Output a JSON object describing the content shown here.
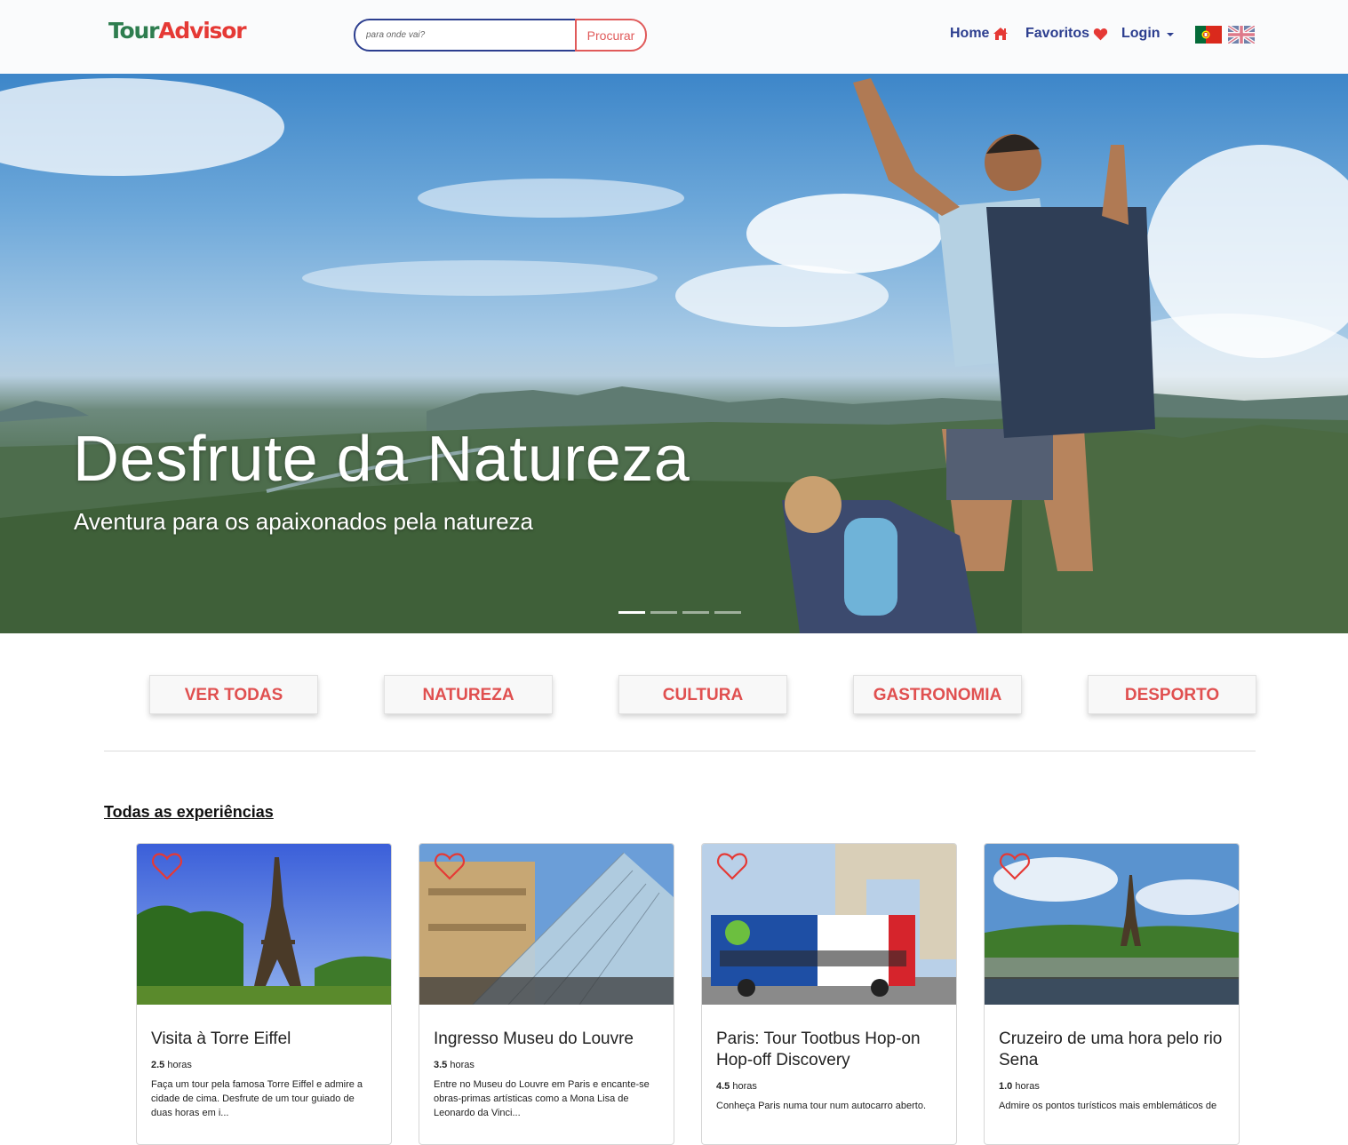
{
  "brand": {
    "part1": "Tour",
    "part2": "Advisor"
  },
  "search": {
    "placeholder": "para onde vai?",
    "button": "Procurar"
  },
  "nav": {
    "home": "Home",
    "favorites": "Favoritos",
    "login": "Login"
  },
  "languages": [
    "pt",
    "en"
  ],
  "hero": {
    "title": "Desfrute da Natureza",
    "subtitle": "Aventura para os apaixonados pela natureza",
    "slides": 4,
    "active_slide": 1
  },
  "categories": [
    "VER TODAS",
    "NATUREZA",
    "CULTURA",
    "GASTRONOMIA",
    "DESPORTO"
  ],
  "section_title": "Todas as experiências",
  "unit": "horas",
  "cards": [
    {
      "title": "Visita à Torre Eiffel",
      "duration": "2.5",
      "desc": "Faça um tour pela famosa Torre Eiffel e admire a cidade de cima. Desfrute de um tour guiado de duas horas em i..."
    },
    {
      "title": "Ingresso Museu do Louvre",
      "duration": "3.5",
      "desc": "Entre no Museu do Louvre em Paris e encante-se obras-primas artísticas como a Mona Lisa de Leonardo da Vinci..."
    },
    {
      "title": "Paris: Tour Tootbus Hop-on Hop-off Discovery",
      "duration": "4.5",
      "desc": "Conheça Paris numa tour num autocarro aberto."
    },
    {
      "title": "Cruzeiro de uma hora pelo rio Sena",
      "duration": "1.0",
      "desc": "Admire os pontos turísticos mais emblemáticos de"
    }
  ],
  "colors": {
    "brand_green": "#2e7d4f",
    "accent_red": "#e05050",
    "nav_blue": "#2c3e8f"
  }
}
